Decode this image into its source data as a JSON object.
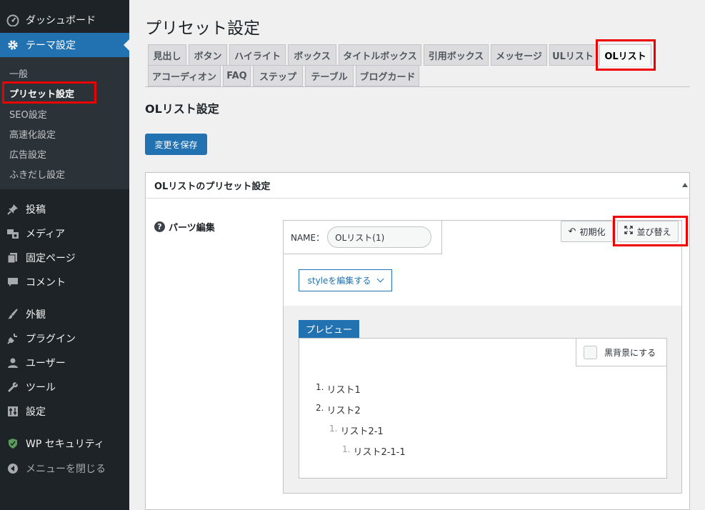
{
  "sidebar": {
    "dashboard": "ダッシュボード",
    "theme_settings": "テーマ設定",
    "submenu": [
      "一般",
      "プリセット設定",
      "SEO設定",
      "高速化設定",
      "広告設定",
      "ふきだし設定"
    ],
    "posts": "投稿",
    "media": "メディア",
    "pages": "固定ページ",
    "comments": "コメント",
    "appearance": "外観",
    "plugins": "プラグイン",
    "users": "ユーザー",
    "tools": "ツール",
    "settings": "設定",
    "wp_security": "WP セキュリティ",
    "collapse": "メニューを閉じる"
  },
  "main": {
    "page_title": "プリセット設定",
    "tabs_row1": [
      "見出し",
      "ボタン",
      "ハイライト",
      "ボックス",
      "タイトルボックス",
      "引用ボックス",
      "メッセージ",
      "ULリスト",
      "OLリスト"
    ],
    "tabs_row2": [
      "アコーディオン",
      "FAQ",
      "ステップ",
      "テーブル",
      "ブログカード"
    ],
    "active_tab": "OLリスト",
    "section_title": "OLリスト設定",
    "save_label": "変更を保存"
  },
  "panel": {
    "title": "OLリストのプリセット設定",
    "parts_label": "パーツ編集",
    "help_icon": "?",
    "name_label": "NAME：",
    "name_value": "OLリスト(1)",
    "reset_label": "初期化",
    "sort_label": "並び替え",
    "style_button": "styleを編集する",
    "preview_tab": "プレビュー",
    "dark_bg_label": "黒背景にする",
    "list_items": [
      {
        "num": "1.",
        "text": "リスト1",
        "level": 1
      },
      {
        "num": "2.",
        "text": "リスト2",
        "level": 1
      },
      {
        "num": "1.",
        "text": "リスト2-1",
        "level": 2
      },
      {
        "num": "1.",
        "text": "リスト2-1-1",
        "level": 3
      }
    ]
  },
  "colors": {
    "accent": "#2271b1",
    "sidebar_bg": "#1d2327",
    "highlight_border": "#e00000"
  }
}
